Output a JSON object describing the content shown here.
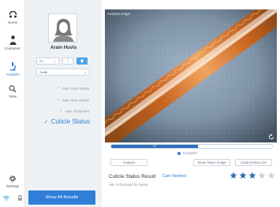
{
  "nav": {
    "items": [
      {
        "label": "Home",
        "icon": "home-logo-icon"
      },
      {
        "label": "Customer",
        "icon": "person-icon"
      },
      {
        "label": "Analysis",
        "icon": "microscope-icon"
      },
      {
        "label": "View",
        "icon": "magnifier-icon"
      }
    ],
    "settings_label": "Settings",
    "active_color": "#2f7ed8"
  },
  "customer": {
    "name": "Aram Huvis",
    "magnification": "2X",
    "area": "Scalp"
  },
  "analysis_menu": {
    "items": [
      {
        "label": "Hair Loss Status",
        "done": true
      },
      {
        "label": "Hair Pore Status",
        "done": true
      },
      {
        "label": "Hair Thickness",
        "done": true
      }
    ],
    "current": "Cuticle Status"
  },
  "show_all_label": "Show All Results",
  "image": {
    "label": "Analysis image"
  },
  "progress": {
    "value": 0.54,
    "label": "37"
  },
  "legend": {
    "label": "Customer"
  },
  "buttons": {
    "analysis": "Analysis",
    "show_taken": "Show Taken Image",
    "control_menu": "Control Menu On"
  },
  "result": {
    "title": "Cuticle Status Result",
    "tag": "Care Needed",
    "description": "Hair is damaged by dyeing",
    "rating": 3,
    "max_rating": 5,
    "star_color": "#2f6fb7",
    "star_empty_color": "#c9d2dc"
  },
  "colors": {
    "accent": "#2f7ed8",
    "panel_bg": "#eef1f4",
    "progress": "#2f6fb7"
  }
}
